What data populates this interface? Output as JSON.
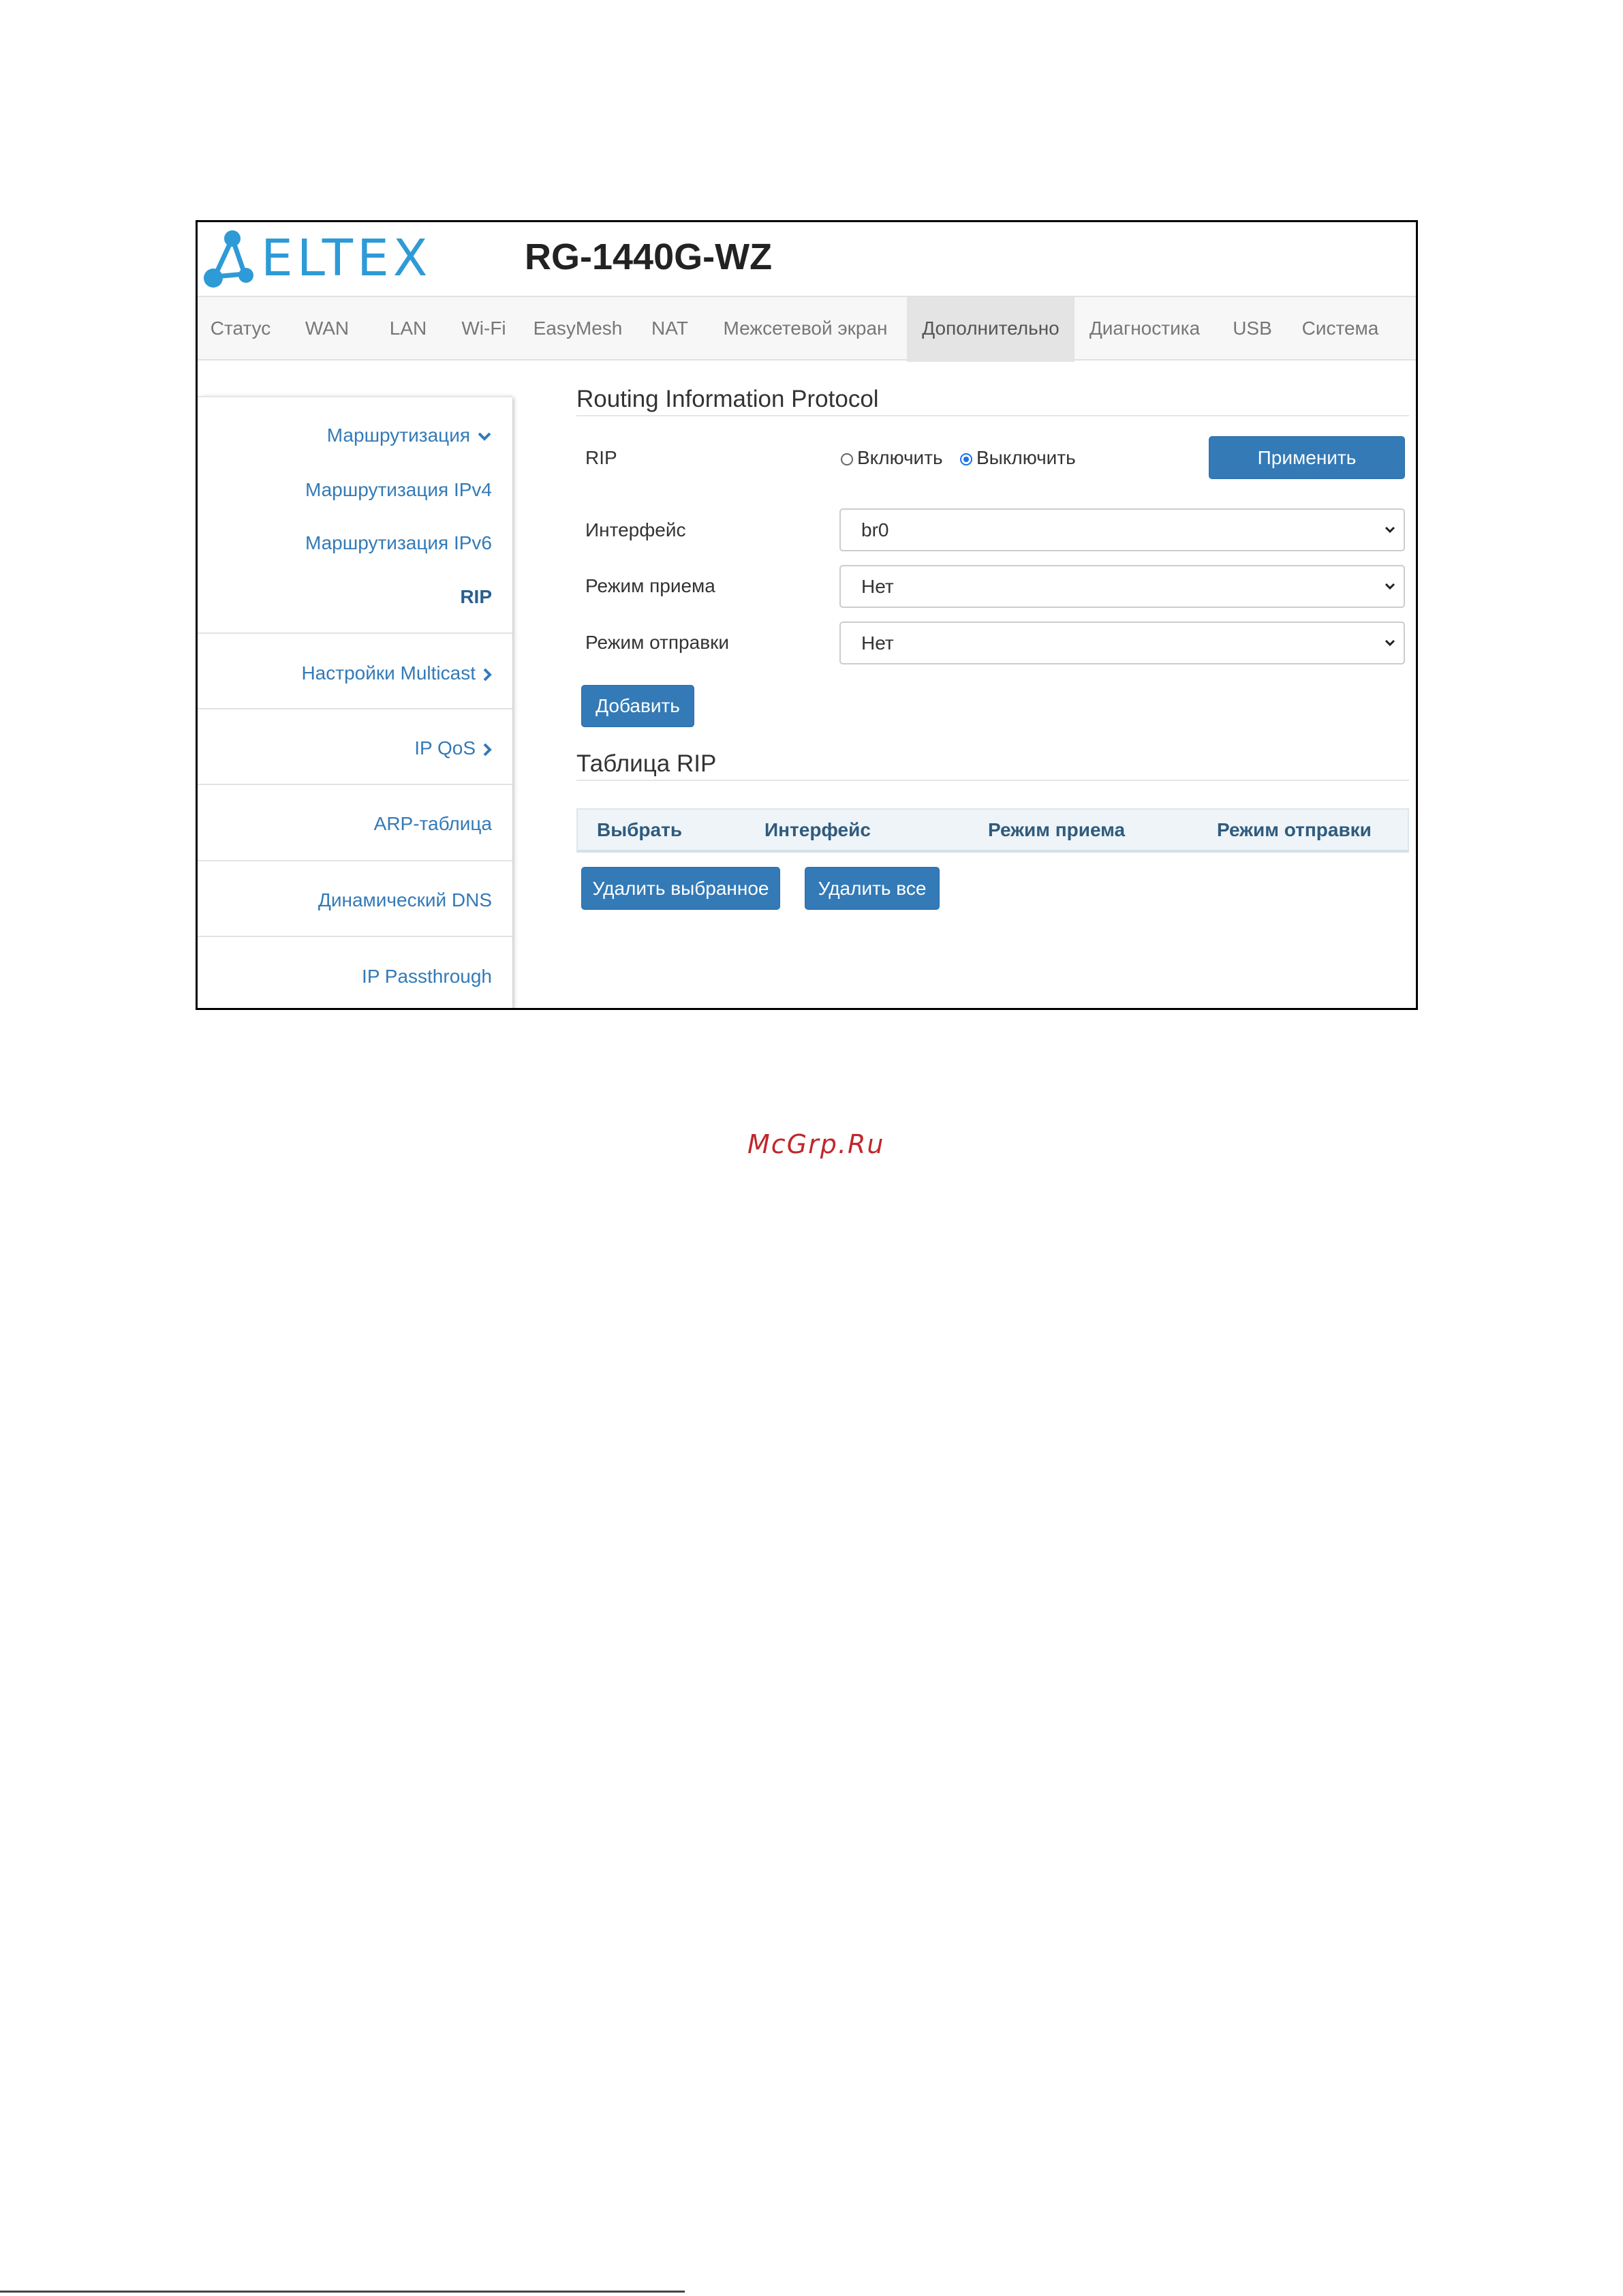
{
  "header": {
    "logo_text": "ELTEX",
    "model": "RG-1440G-WZ",
    "brand_color": "#2e9ad6"
  },
  "topnav": {
    "tabs": [
      {
        "label": "Статус"
      },
      {
        "label": "WAN"
      },
      {
        "label": "LAN"
      },
      {
        "label": "Wi-Fi"
      },
      {
        "label": "EasyMesh"
      },
      {
        "label": "NAT"
      },
      {
        "label": "Межсетевой экран"
      },
      {
        "label": "Дополнительно",
        "active": true
      },
      {
        "label": "Диагностика"
      },
      {
        "label": "USB"
      },
      {
        "label": "Система"
      }
    ]
  },
  "sidebar": {
    "items": [
      {
        "label": "Маршрутизация",
        "icon": "chevron-down-icon"
      },
      {
        "label": "Маршрутизация IPv4"
      },
      {
        "label": "Маршрутизация IPv6"
      },
      {
        "label": "RIP",
        "active": true
      },
      {
        "label": "Настройки Multicast",
        "icon": "chevron-right-icon"
      },
      {
        "label": "IP QoS",
        "icon": "chevron-right-icon"
      },
      {
        "label": "ARP-таблица"
      },
      {
        "label": "Динамический DNS"
      },
      {
        "label": "IP Passthrough"
      }
    ]
  },
  "main": {
    "title": "Routing Information Protocol",
    "rip": {
      "label": "RIP",
      "options": [
        "Включить",
        "Выключить"
      ],
      "selected": "Выключить",
      "apply_label": "Применить"
    },
    "interface": {
      "label": "Интерфейс",
      "value": "br0"
    },
    "receive_mode": {
      "label": "Режим приема",
      "value": "Нет"
    },
    "send_mode": {
      "label": "Режим отправки",
      "value": "Нет"
    },
    "add_label": "Добавить",
    "table": {
      "title": "Таблица RIP",
      "columns": [
        "Выбрать",
        "Интерфейс",
        "Режим приема",
        "Режим отправки"
      ],
      "rows": []
    },
    "delete_selected_label": "Удалить выбранное",
    "delete_all_label": "Удалить все"
  },
  "watermark": "McGrp.Ru"
}
